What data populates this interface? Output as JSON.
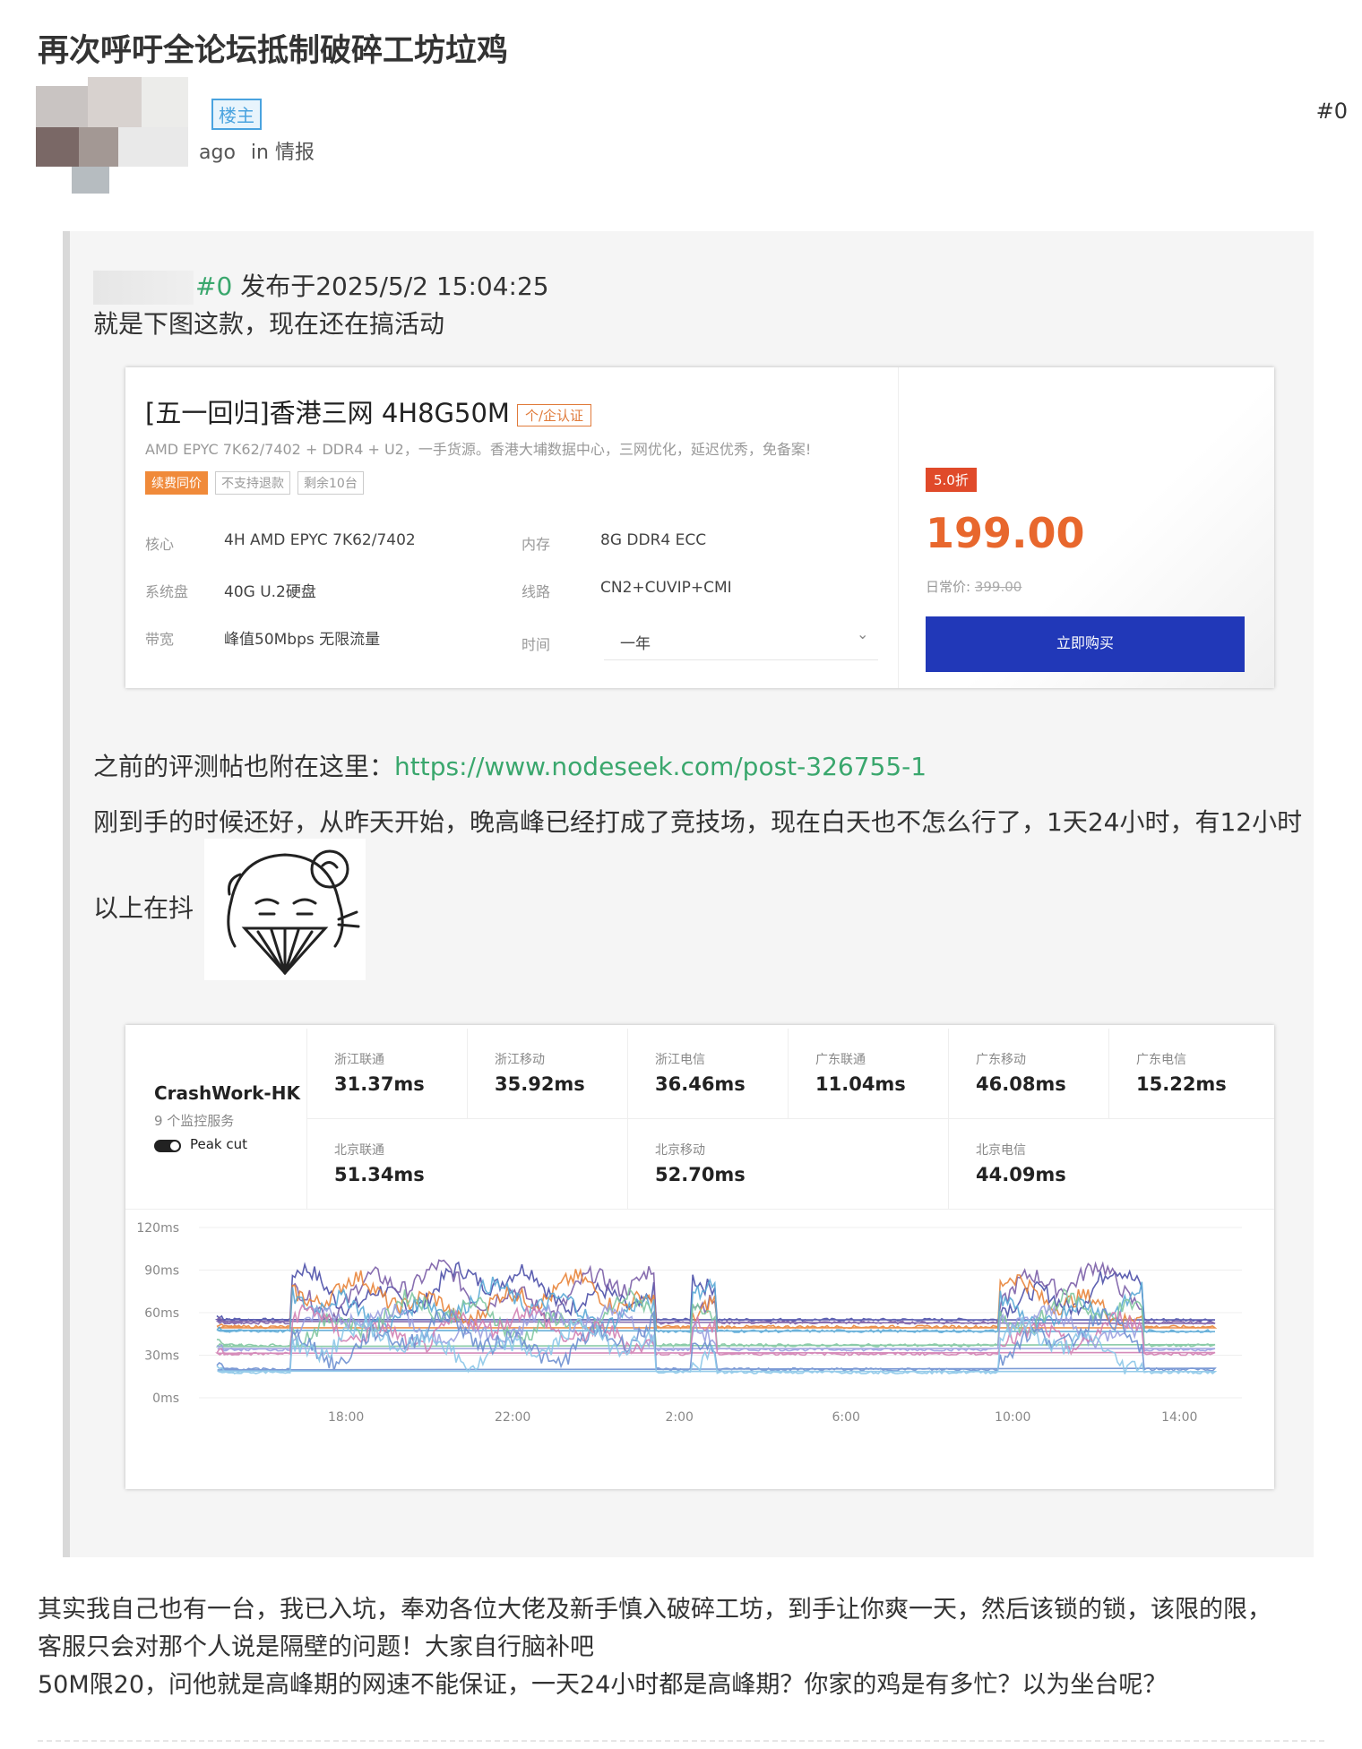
{
  "post": {
    "title": "再次呼吁全论坛抵制破碎工坊垃鸡",
    "op_badge": "楼主",
    "time_ago": "ago",
    "in_label": "in",
    "category": "情报",
    "floor": "#0"
  },
  "quote": {
    "floor_ref": "#0",
    "posted_at": "发布于2025/5/2 15:04:25",
    "line1": "就是下图这款，现在还在搞活动",
    "review_prefix": "之前的评测帖也附在这里：",
    "review_link": "https://www.nodeseek.com/post-326755-1",
    "line3": "刚到手的时候还好，从昨天开始，晚高峰已经打成了竞技场，现在白天也不怎么行了，1天24小时，有12小时",
    "line4": "以上在抖"
  },
  "product": {
    "title": "[五一回归]香港三网 4H8G50M",
    "cert_badge": "个/企认证",
    "description": "AMD EPYC 7K62/7402 + DDR4 + U2，一手货源。香港大埔数据中心，三网优化，延迟优秀，免备案!",
    "tags": [
      "续费同价",
      "不支持退款",
      "剩余10台"
    ],
    "specs": {
      "core_label": "核心",
      "core_value": "4H AMD EPYC 7K62/7402",
      "mem_label": "内存",
      "mem_value": "8G DDR4 ECC",
      "disk_label": "系统盘",
      "disk_value": "40G U.2硬盘",
      "line_label": "线路",
      "line_value": "CN2+CUVIP+CMI",
      "bw_label": "带宽",
      "bw_value": "峰值50Mbps 无限流量",
      "time_label": "时间",
      "time_value": "一年"
    },
    "discount": "5.0折",
    "price": "199.00",
    "orig_label": "日常价:",
    "orig_price": "399.00",
    "buy_label": "立即购买"
  },
  "monitor": {
    "server_name": "CrashWork-HK",
    "service_count": "9 个监控服务",
    "toggle_label": "Peak cut",
    "cells": [
      {
        "name": "浙江联通",
        "value": "31.37ms"
      },
      {
        "name": "浙江移动",
        "value": "35.92ms"
      },
      {
        "name": "浙江电信",
        "value": "36.46ms"
      },
      {
        "name": "广东联通",
        "value": "11.04ms"
      },
      {
        "name": "广东移动",
        "value": "46.08ms"
      },
      {
        "name": "广东电信",
        "value": "15.22ms"
      },
      {
        "name": "北京联通",
        "value": "51.34ms"
      },
      {
        "name": "北京移动",
        "value": "52.70ms"
      },
      {
        "name": "北京电信",
        "value": "44.09ms"
      }
    ]
  },
  "chart_data": {
    "type": "line",
    "title": "",
    "xlabel": "",
    "ylabel": "",
    "y_ticks": [
      "120ms",
      "90ms",
      "60ms",
      "30ms",
      "0ms"
    ],
    "ylim": [
      0,
      120
    ],
    "x_ticks": [
      "18:00",
      "22:00",
      "2:00",
      "6:00",
      "10:00",
      "14:00"
    ],
    "x_range_hours": [
      14.9,
      15.5
    ],
    "grid": true,
    "legend": "none",
    "colors": [
      "#4b4fa8",
      "#7b5ea7",
      "#e8843a",
      "#5aa9d6",
      "#7fc7a0",
      "#9aa0e0",
      "#d27fb3",
      "#6d8fd0",
      "#8bc7e8"
    ],
    "series_baselines_ms": [
      55,
      53,
      50,
      47,
      37,
      34,
      31,
      20,
      18
    ],
    "peak_extra_ms": [
      40,
      42,
      35,
      33,
      36,
      30,
      32,
      38,
      34
    ],
    "peak_windows": [
      [
        16.7,
        1.4
      ],
      [
        2.3,
        2.9
      ],
      [
        9.7,
        13.1
      ]
    ]
  },
  "body": {
    "line1": "其实我自己也有一台，我已入坑，奉劝各位大佬及新手慎入破碎工坊，到手让你爽一天，然后该锁的锁，该限的限，",
    "line2": "客服只会对那个人说是隔壁的问题！大家自行脑补吧",
    "line3": "50M限20，问他就是高峰期的网速不能保证，一天24小时都是高峰期？你家的鸡是有多忙？以为坐台呢？"
  }
}
